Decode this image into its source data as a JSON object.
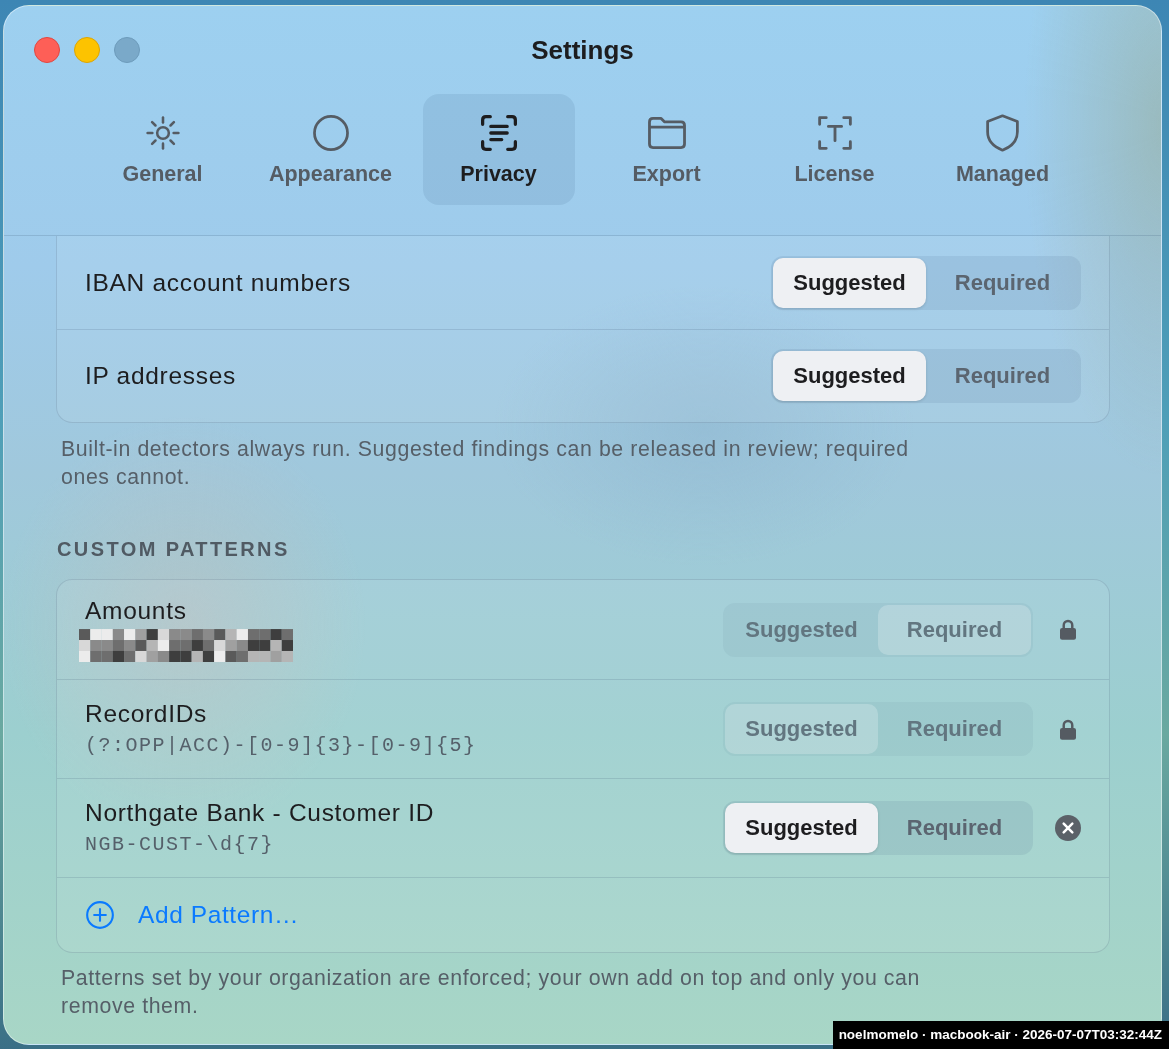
{
  "window": {
    "title": "Settings"
  },
  "tabs": [
    {
      "label": "General",
      "selected": false
    },
    {
      "label": "Appearance",
      "selected": false
    },
    {
      "label": "Privacy",
      "selected": true
    },
    {
      "label": "Export",
      "selected": false
    },
    {
      "label": "License",
      "selected": false
    },
    {
      "label": "Managed",
      "selected": false
    }
  ],
  "builtin_detectors": {
    "rows": [
      {
        "label": "IBAN account numbers",
        "options": [
          {
            "label": "Suggested",
            "selected": true
          },
          {
            "label": "Required",
            "selected": false
          }
        ]
      },
      {
        "label": "IP addresses",
        "options": [
          {
            "label": "Suggested",
            "selected": true
          },
          {
            "label": "Required",
            "selected": false
          }
        ]
      }
    ],
    "note": "Built-in detectors always run. Suggested findings can be released in review; required ones cannot."
  },
  "custom_patterns": {
    "heading": "CUSTOM PATTERNS",
    "rows": [
      {
        "name": "Amounts",
        "redacted": true,
        "locked": true,
        "options": [
          {
            "label": "Suggested",
            "selected": false
          },
          {
            "label": "Required",
            "selected": true
          }
        ]
      },
      {
        "name": "RecordIDs",
        "pattern": "(?:OPP|ACC)-[0-9]{3}-[0-9]{5}",
        "redacted": false,
        "locked": true,
        "options": [
          {
            "label": "Suggested",
            "selected": true
          },
          {
            "label": "Required",
            "selected": false
          }
        ]
      },
      {
        "name": "Northgate Bank - Customer ID",
        "pattern": "NGB-CUST-\\d{7}",
        "redacted": false,
        "locked": false,
        "options": [
          {
            "label": "Suggested",
            "selected": true
          },
          {
            "label": "Required",
            "selected": false
          }
        ]
      }
    ],
    "add_button": {
      "label": "Add Pattern…"
    },
    "note": "Patterns set by your organization are enforced; your own add on top and only you can remove them."
  },
  "capture_label": "noelmomelo · macbook-air · 2026-07-07T03:32:44Z"
}
